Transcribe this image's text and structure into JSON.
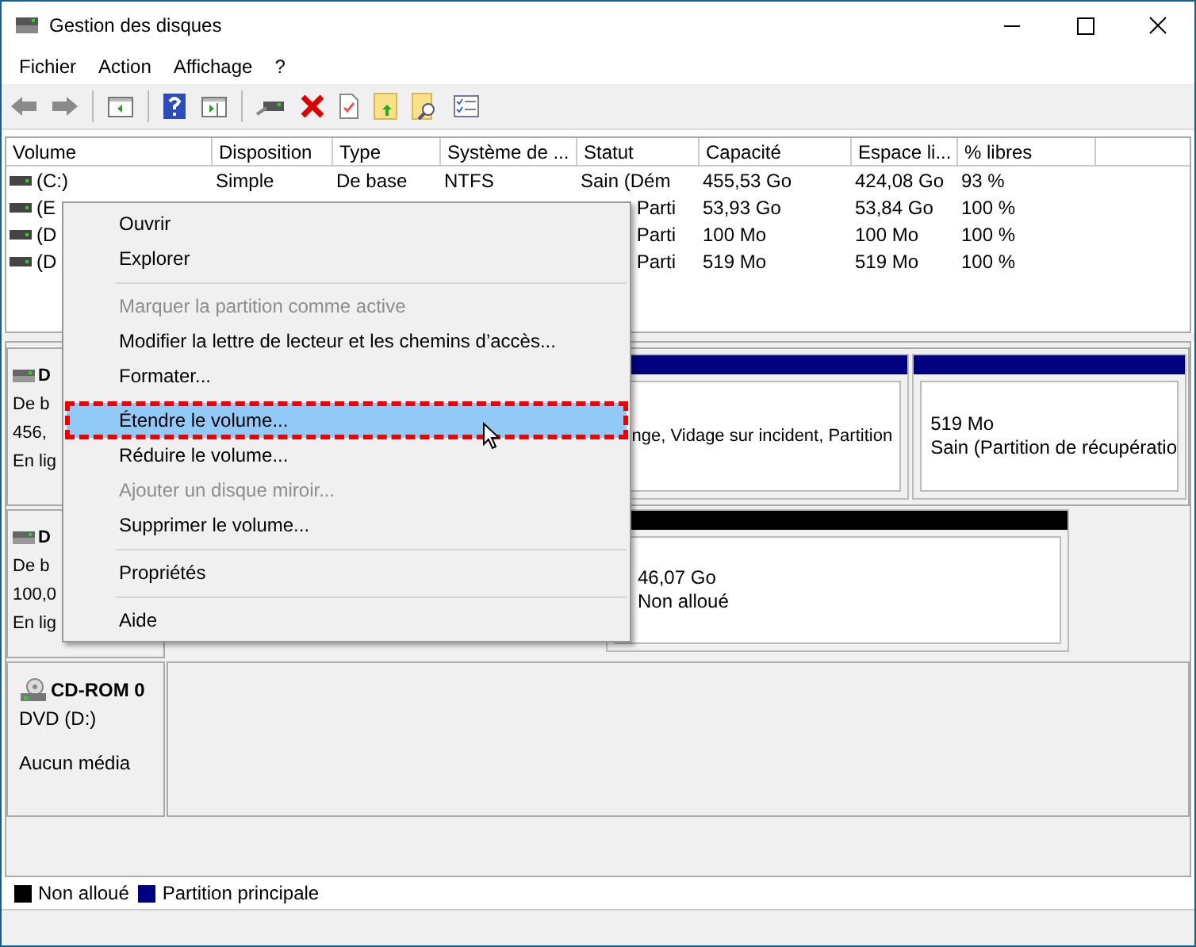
{
  "window": {
    "title": "Gestion des disques"
  },
  "menu_bar": [
    "Fichier",
    "Action",
    "Affichage",
    "?"
  ],
  "table": {
    "columns": [
      "Volume",
      "Disposition",
      "Type",
      "Système de ...",
      "Statut",
      "Capacité",
      "Espace li...",
      "% libres"
    ],
    "rows": [
      {
        "covered": false,
        "cells": [
          "(C:)",
          "Simple",
          "De base",
          "NTFS",
          "Sain (Dém",
          "455,53 Go",
          "424,08 Go",
          "93 %"
        ]
      },
      {
        "covered": true,
        "cells": [
          "(E",
          "Parti",
          "53,93 Go",
          "53,84 Go",
          "100 %"
        ]
      },
      {
        "covered": true,
        "cells": [
          "(D",
          "Parti",
          "100 Mo",
          "100 Mo",
          "100 %"
        ]
      },
      {
        "covered": true,
        "cells": [
          "(D",
          "Parti",
          "519 Mo",
          "519 Mo",
          "100 %"
        ]
      }
    ]
  },
  "disks": [
    {
      "kind": "hdd",
      "name": "D",
      "lines": [
        "De b",
        "456,",
        "En lig"
      ],
      "partitions": [
        {
          "kind": "primary",
          "covered": true,
          "lines": [
            "nge, Vidage sur incident, Partition"
          ]
        },
        {
          "kind": "primary",
          "covered": false,
          "lines": [
            "519 Mo",
            "Sain (Partition de récupératio"
          ]
        }
      ]
    },
    {
      "kind": "hdd",
      "name": "D",
      "lines": [
        "De b",
        "100,0",
        "En lig"
      ],
      "partitions": [
        {
          "kind": "unallocated",
          "covered": false,
          "lines": [
            "46,07 Go",
            "Non alloué"
          ]
        }
      ]
    },
    {
      "kind": "cdrom",
      "name": "CD-ROM 0",
      "lines": [
        "DVD (D:)",
        "Aucun média"
      ]
    }
  ],
  "legend": [
    {
      "label": "Non alloué",
      "color": "#000000"
    },
    {
      "label": "Partition principale",
      "color": "#000080"
    }
  ],
  "context_menu": [
    {
      "kind": "item",
      "label": "Ouvrir",
      "disabled": false,
      "selected": false
    },
    {
      "kind": "item",
      "label": "Explorer",
      "disabled": false,
      "selected": false
    },
    {
      "kind": "separator"
    },
    {
      "kind": "item",
      "label": "Marquer la partition comme active",
      "disabled": true,
      "selected": false
    },
    {
      "kind": "item",
      "label": "Modifier la lettre de lecteur et les chemins d’accès...",
      "disabled": false,
      "selected": false
    },
    {
      "kind": "item",
      "label": "Formater...",
      "disabled": false,
      "selected": false
    },
    {
      "kind": "item",
      "label": "Étendre le volume...",
      "disabled": false,
      "selected": true
    },
    {
      "kind": "item",
      "label": "Réduire le volume...",
      "disabled": false,
      "selected": false
    },
    {
      "kind": "item",
      "label": "Ajouter un disque miroir...",
      "disabled": true,
      "selected": false
    },
    {
      "kind": "item",
      "label": "Supprimer le volume...",
      "disabled": false,
      "selected": false
    },
    {
      "kind": "separator"
    },
    {
      "kind": "item",
      "label": "Propriétés",
      "disabled": false,
      "selected": false
    },
    {
      "kind": "separator"
    },
    {
      "kind": "item",
      "label": "Aide",
      "disabled": false,
      "selected": false
    }
  ]
}
